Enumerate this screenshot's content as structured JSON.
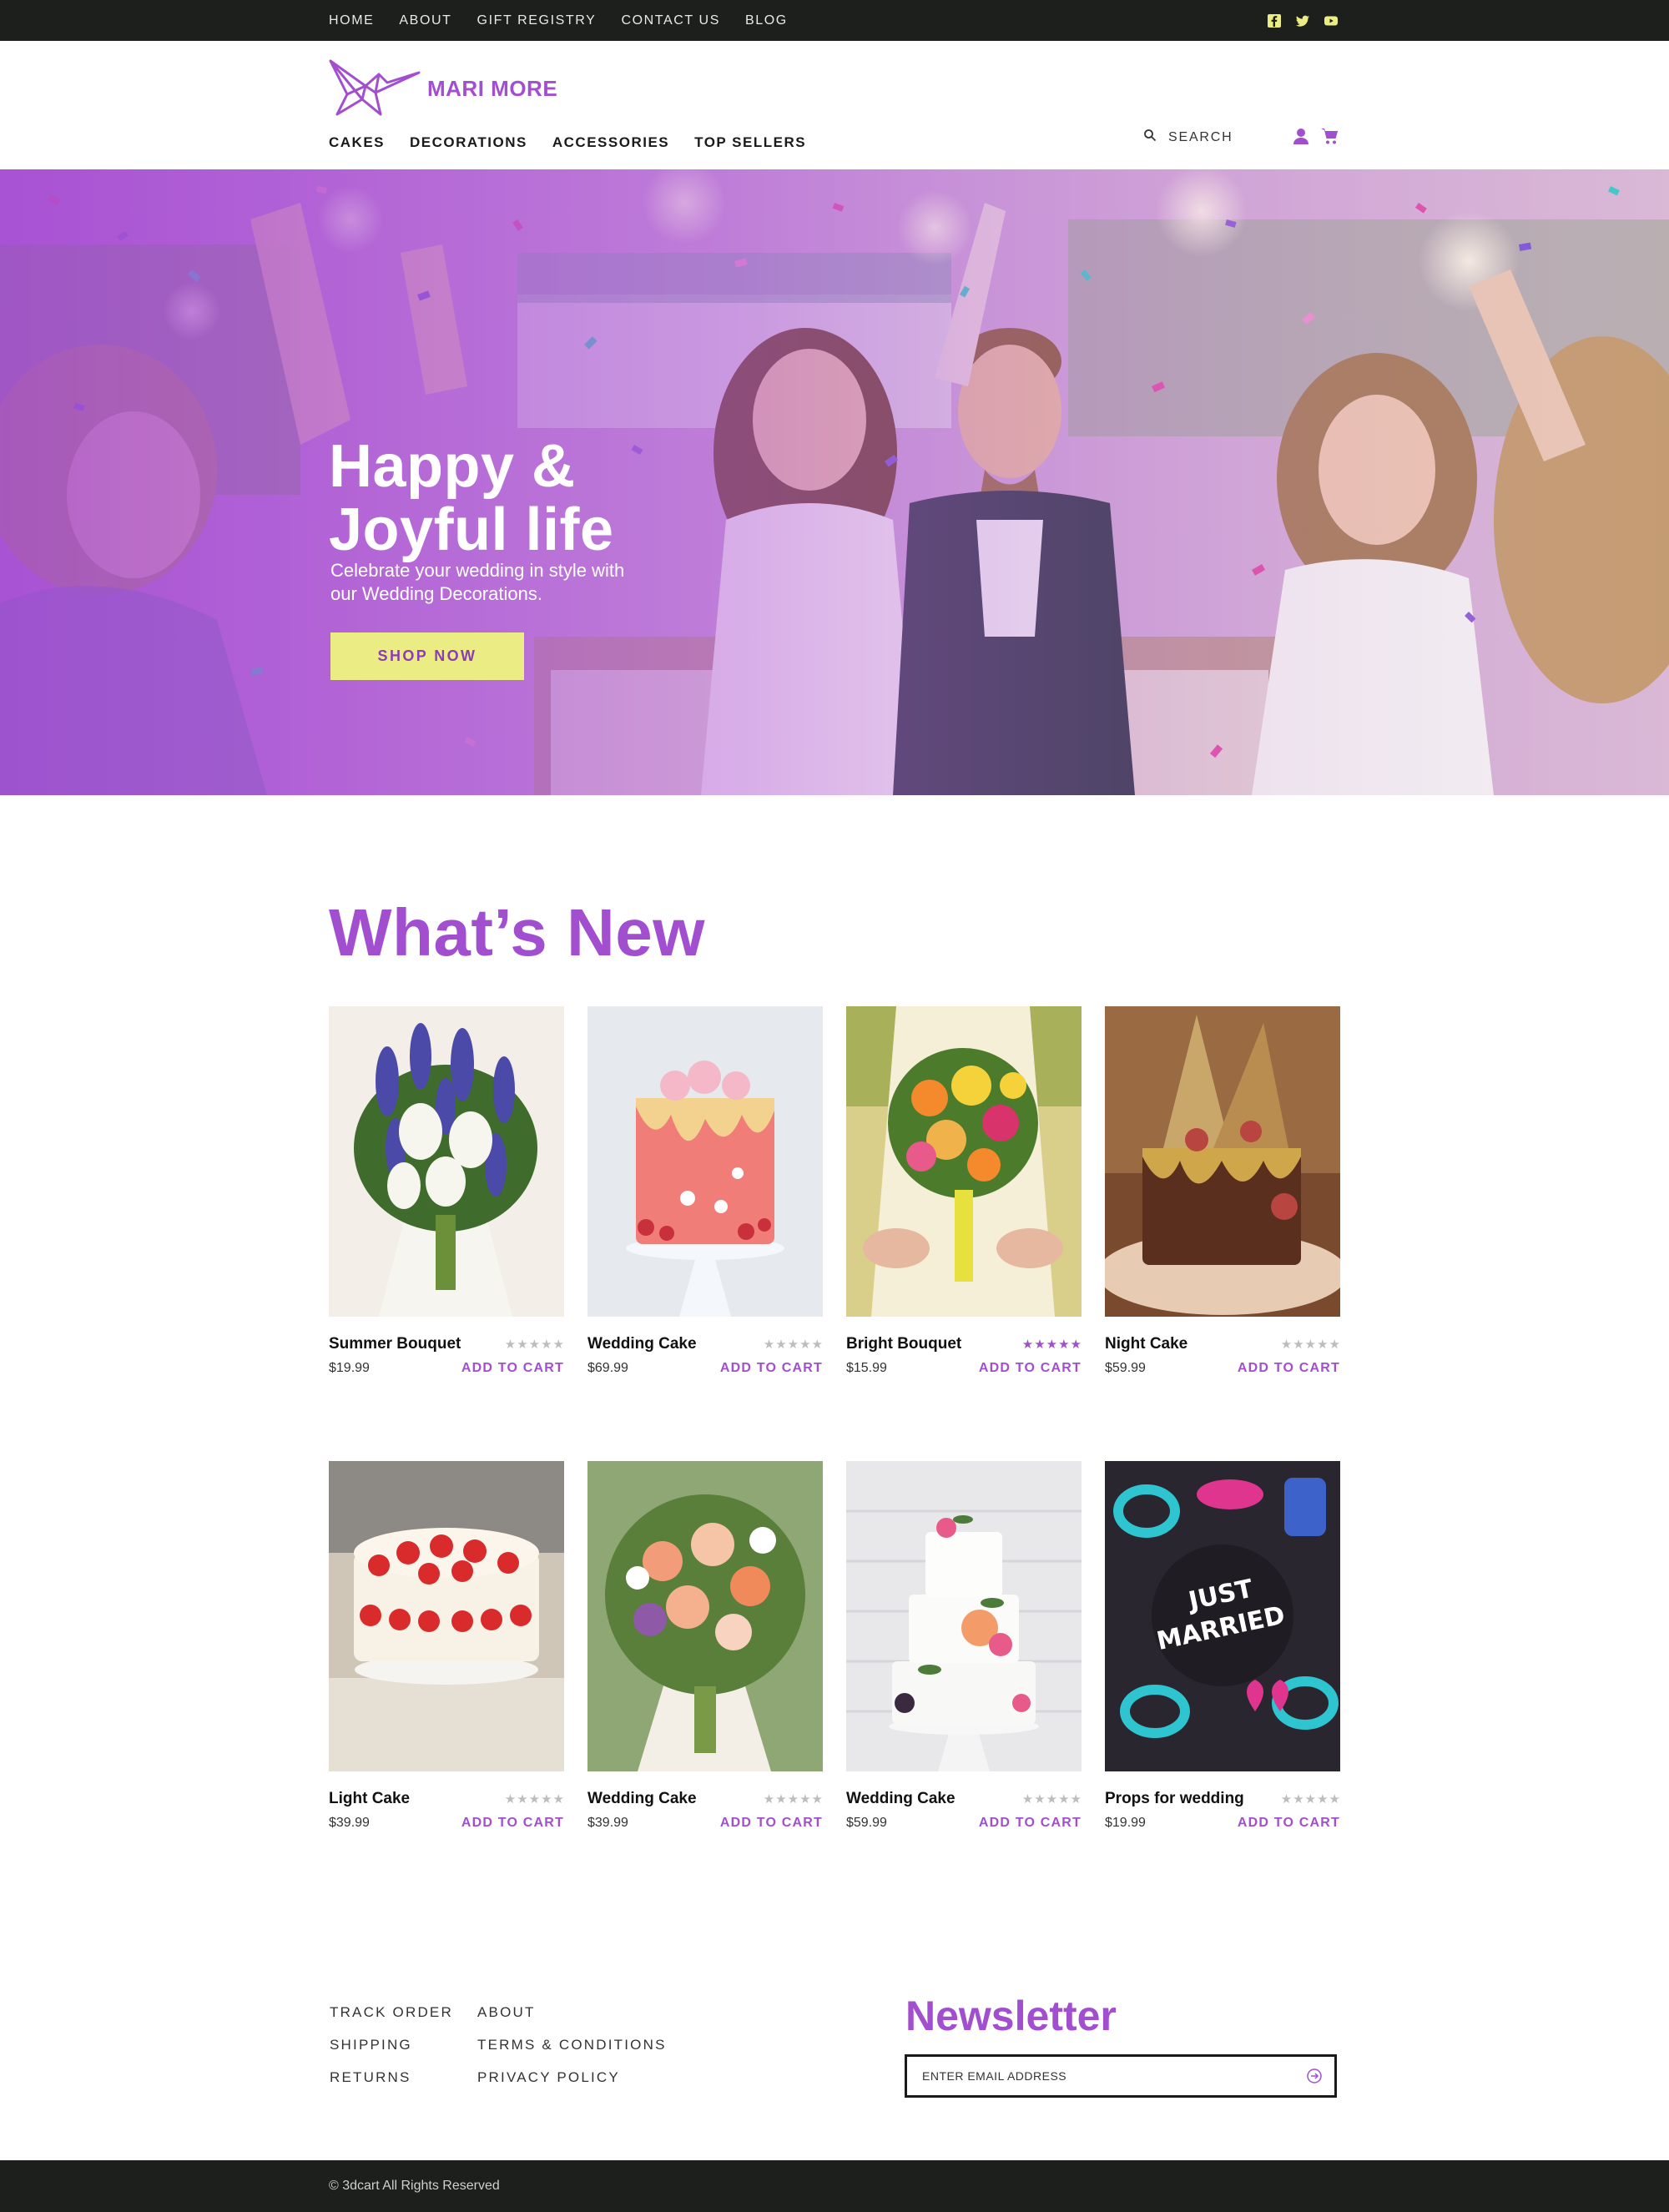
{
  "topbar": {
    "links": [
      "HOME",
      "ABOUT",
      "GIFT REGISTRY",
      "CONTACT US",
      "BLOG"
    ],
    "social_icons": [
      "facebook-icon",
      "twitter-icon",
      "youtube-icon"
    ],
    "icon_color": "#ecec84"
  },
  "header": {
    "brand": "MARI MORE",
    "nav": [
      "CAKES",
      "DECORATIONS",
      "ACCESSORIES",
      "TOP SELLERS"
    ],
    "search_label": "SEARCH",
    "icons": [
      "search-icon",
      "user-icon",
      "cart-icon"
    ]
  },
  "hero": {
    "title_line1": "Happy &",
    "title_line2": "Joyful life",
    "subtitle_line1": "Celebrate your wedding in style with",
    "subtitle_line2": "our Wedding Decorations.",
    "button": "SHOP NOW"
  },
  "whats_new": {
    "title": "What’s New",
    "add_label": "ADD TO CART",
    "products": [
      {
        "name": "Summer Bouquet",
        "price": "$19.99",
        "rating": 0
      },
      {
        "name": "Wedding Cake",
        "price": "$69.99",
        "rating": 0
      },
      {
        "name": "Bright Bouquet",
        "price": "$15.99",
        "rating": 5
      },
      {
        "name": "Night Cake",
        "price": "$59.99",
        "rating": 0
      },
      {
        "name": "Light Cake",
        "price": "$39.99",
        "rating": 0
      },
      {
        "name": "Wedding Cake",
        "price": "$39.99",
        "rating": 0
      },
      {
        "name": "Wedding Cake",
        "price": "$59.99",
        "rating": 0
      },
      {
        "name": "Props for wedding",
        "price": "$19.99",
        "rating": 0
      }
    ]
  },
  "footer": {
    "col1": [
      "TRACK ORDER",
      "SHIPPING",
      "RETURNS"
    ],
    "col2": [
      "ABOUT",
      "TERMS & CONDITIONS",
      "PRIVACY POLICY"
    ],
    "newsletter_title": "Newsletter",
    "email_placeholder": "ENTER EMAIL ADDRESS",
    "copyright": "© 3dcart All Rights Reserved"
  },
  "colors": {
    "accent": "#a24fcf",
    "button_yellow": "#ecec84",
    "dark_bar": "#1d1f1c"
  }
}
